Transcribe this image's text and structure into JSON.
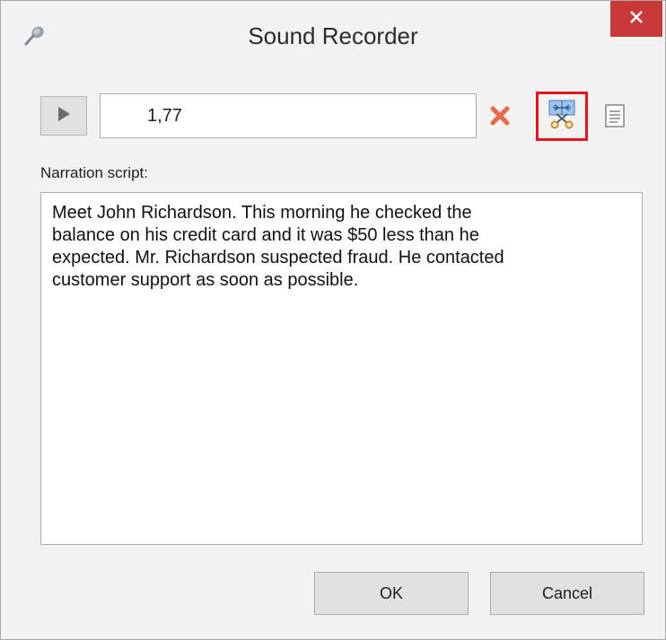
{
  "window": {
    "title": "Sound Recorder",
    "title_icon": "microphone-icon",
    "close_icon": "close-icon"
  },
  "toolbar": {
    "play_icon": "play-icon",
    "duration_value": "1,77",
    "delete_icon": "delete-icon",
    "trim_icon": "trim-audio-icon",
    "script_icon": "script-icon",
    "trim_highlight_color": "#e8141c"
  },
  "narration": {
    "label": "Narration script:",
    "text": "Meet John Richardson. This morning he checked the\nbalance on his credit card and it was $50 less than he\nexpected. Mr. Richardson suspected fraud. He contacted\ncustomer support as soon as possible."
  },
  "buttons": {
    "ok_label": "OK",
    "cancel_label": "Cancel"
  },
  "colors": {
    "close_bg": "#c9393a",
    "delete_icon": "#e8684a"
  }
}
